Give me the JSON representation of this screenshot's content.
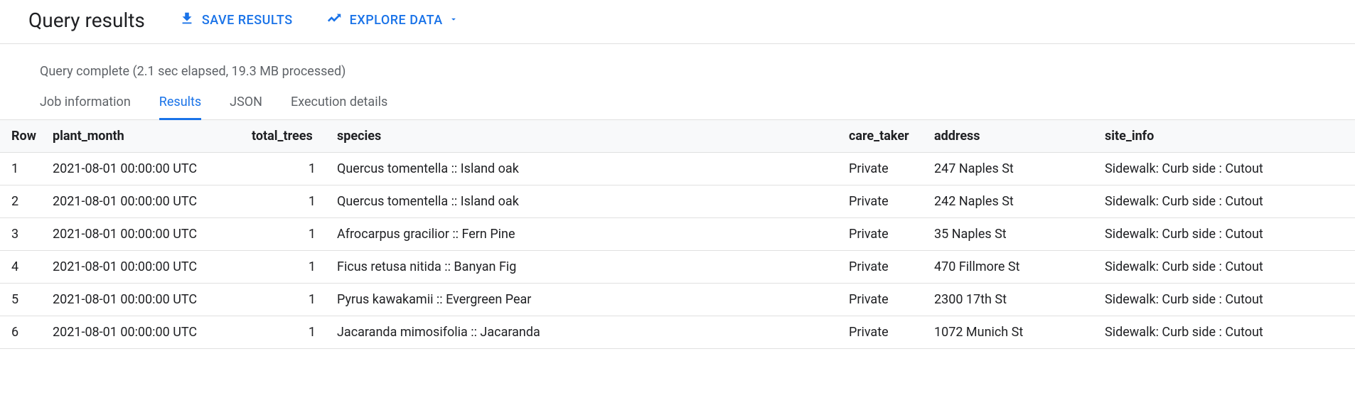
{
  "header": {
    "title": "Query results",
    "save_label": "SAVE RESULTS",
    "explore_label": "EXPLORE DATA"
  },
  "status": "Query complete (2.1 sec elapsed, 19.3 MB processed)",
  "tabs": [
    {
      "label": "Job information",
      "active": false
    },
    {
      "label": "Results",
      "active": true
    },
    {
      "label": "JSON",
      "active": false
    },
    {
      "label": "Execution details",
      "active": false
    }
  ],
  "table": {
    "columns": [
      "Row",
      "plant_month",
      "total_trees",
      "species",
      "care_taker",
      "address",
      "site_info"
    ],
    "rows": [
      {
        "row": "1",
        "plant_month": "2021-08-01 00:00:00 UTC",
        "total_trees": "1",
        "species": "Quercus tomentella :: Island oak",
        "care_taker": "Private",
        "address": "247 Naples St",
        "site_info": "Sidewalk: Curb side : Cutout"
      },
      {
        "row": "2",
        "plant_month": "2021-08-01 00:00:00 UTC",
        "total_trees": "1",
        "species": "Quercus tomentella :: Island oak",
        "care_taker": "Private",
        "address": "242 Naples St",
        "site_info": "Sidewalk: Curb side : Cutout"
      },
      {
        "row": "3",
        "plant_month": "2021-08-01 00:00:00 UTC",
        "total_trees": "1",
        "species": "Afrocarpus gracilior :: Fern Pine",
        "care_taker": "Private",
        "address": "35 Naples St",
        "site_info": "Sidewalk: Curb side : Cutout"
      },
      {
        "row": "4",
        "plant_month": "2021-08-01 00:00:00 UTC",
        "total_trees": "1",
        "species": "Ficus retusa nitida :: Banyan Fig",
        "care_taker": "Private",
        "address": "470 Fillmore St",
        "site_info": "Sidewalk: Curb side : Cutout"
      },
      {
        "row": "5",
        "plant_month": "2021-08-01 00:00:00 UTC",
        "total_trees": "1",
        "species": "Pyrus kawakamii :: Evergreen Pear",
        "care_taker": "Private",
        "address": "2300 17th St",
        "site_info": "Sidewalk: Curb side : Cutout"
      },
      {
        "row": "6",
        "plant_month": "2021-08-01 00:00:00 UTC",
        "total_trees": "1",
        "species": "Jacaranda mimosifolia :: Jacaranda",
        "care_taker": "Private",
        "address": "1072 Munich St",
        "site_info": "Sidewalk: Curb side : Cutout"
      }
    ]
  }
}
